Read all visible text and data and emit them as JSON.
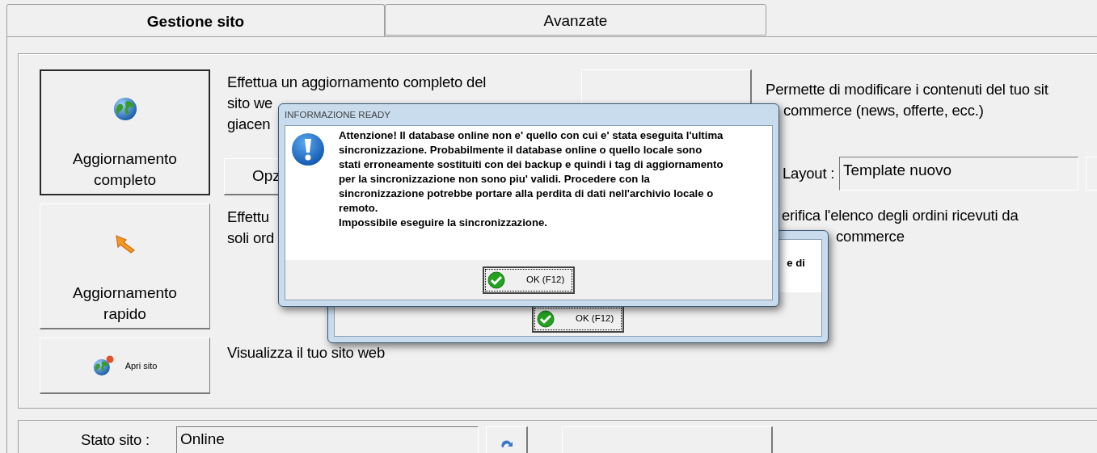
{
  "tabs": [
    {
      "label": "Gestione sito",
      "selected": true
    },
    {
      "label": "Avanzate",
      "selected": false
    }
  ],
  "actions": [
    {
      "kind": "full",
      "label": "Aggiornamento completo",
      "focused": true,
      "description": [
        "Effettua un aggiornamento completo del",
        "sito we",
        "giacen"
      ],
      "option_button": "Opz"
    },
    {
      "kind": "quick",
      "label": "Aggiornamento rapido",
      "focused": false,
      "description": [
        "Effettu",
        "soli ord"
      ]
    },
    {
      "kind": "open",
      "label": "Apri sito",
      "focused": false,
      "description": [
        "Visualizza il tuo sito web"
      ]
    }
  ],
  "content_panel": {
    "description": [
      "Permette di modificare i contenuti del tuo sit",
      "commerce (news, offerte, ecc.)"
    ],
    "layout_label": "Layout :",
    "layout_value": "Template nuovo"
  },
  "orders_panel": {
    "description": [
      "erifica l'elenco degli ordini ricevuti da",
      "commerce"
    ]
  },
  "status": {
    "label": "Stato sito :",
    "value": "Online"
  },
  "dialogs": [
    {
      "message": [
        "e di"
      ],
      "button": "OK (F12)"
    },
    {
      "title": "INFORMAZIONE READY",
      "message": [
        "Attenzione! Il database online non e' quello con cui e' stata eseguita l'ultima",
        "sincronizzazione. Probabilmente il database online o quello locale sono",
        "stati erroneamente sostituiti con dei backup e quindi i tag di aggiornamento",
        "per la sincronizzazione non sono piu' validi. Procedere con la",
        "sincronizzazione potrebbe portare alla perdita di dati nell'archivio locale o",
        "remoto.",
        "Impossibile eseguire la sincronizzazione."
      ],
      "button": "OK (F12)"
    }
  ]
}
